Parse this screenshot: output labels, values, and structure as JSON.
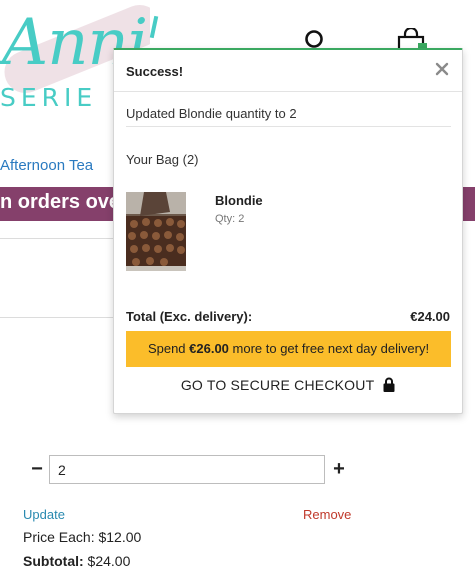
{
  "brand": {
    "logo_script": "Anni",
    "logo_sub": "SERIE"
  },
  "nav": {
    "link_afternoon_tea": "Afternoon Tea"
  },
  "banner": {
    "text": "n orders ove"
  },
  "toast": {
    "title": "Success!",
    "message": "Updated Blondie quantity to 2",
    "bag_label": "Your Bag (2)",
    "item": {
      "name": "Blondie",
      "qty_label": "Qty: 2"
    },
    "total_label": "Total (Exc. delivery):",
    "total_value": "€24.00",
    "delivery": {
      "prefix": "Spend ",
      "amount": "€26.00",
      "suffix": " more to get free next day delivery!"
    },
    "checkout_label": "GO TO SECURE CHECKOUT"
  },
  "cart_item": {
    "quantity_value": "2",
    "minus_label": "−",
    "plus_label": "+",
    "update_label": "Update",
    "remove_label": "Remove",
    "price_each_label": "Price Each:",
    "price_each_value": "$12.00",
    "subtotal_label": "Subtotal:",
    "subtotal_value": "$24.00"
  },
  "icons": {
    "account": "account-icon",
    "bag": "shopping-bag-icon",
    "close": "close-icon",
    "lock": "lock-icon"
  },
  "colors": {
    "brand_teal": "#48ccc5",
    "banner_plum": "#85406b",
    "success_green": "#3aa860",
    "notice_yellow": "#fbbd2a",
    "link_blue": "#2a7ac0",
    "remove_red": "#c0392b"
  }
}
